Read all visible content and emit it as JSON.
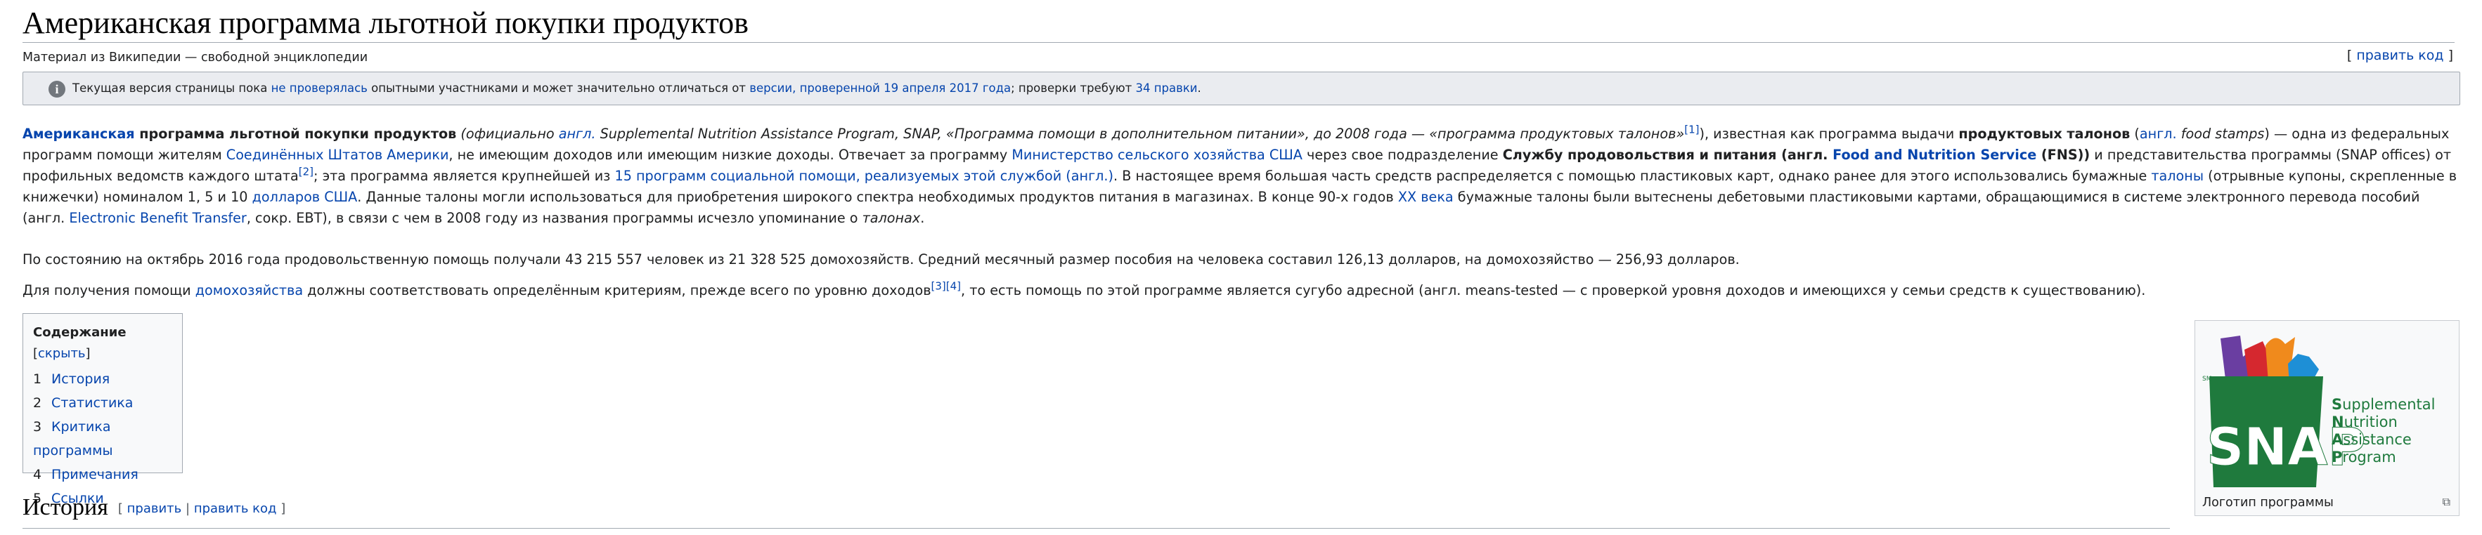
{
  "page": {
    "title": "Американская программа льготной покупки продуктов",
    "tagline": "Материал из Википедии — свободной энциклопедии",
    "edit_code_label": "править код"
  },
  "notice": {
    "icon": "info-icon",
    "prefix": "Текущая версия страницы пока ",
    "link_unchecked": "не проверялась",
    "middle": " опытными участниками и может значительно отличаться от ",
    "link_version": "версии, проверенной 19 апреля 2017 года",
    "after": "; проверки требуют ",
    "link_edits": "34 правки",
    "end": "."
  },
  "paragraph1": {
    "t1": "Американская",
    "t2": " программа льготной покупки продуктов",
    "t3": " (официально ",
    "t4": "англ.",
    "t5": " Supplemental Nutrition Assistance Program, SNAP, «Программа помощи в дополнительном питании», до 2008 года — «программа продуктовых талонов»",
    "t6": "[1]",
    "t7": "), известная как программа выдачи ",
    "t8": "продуктовых талонов",
    "t9": " (",
    "t10": "англ.",
    "t11": " food stamps",
    "t12": ") — одна из федеральных программ помощи жителям ",
    "t13": "Соединённых Штатов Америки",
    "t14": ", не имеющим доходов или имеющим низкие доходы. Отвечает за программу ",
    "t15": "Министерство сельского хозяйства США",
    "t16": " через свое подразделение ",
    "t17": "Службу продовольствия и питания (англ. ",
    "t18": "Food and Nutrition Service",
    "t19": " (FNS))",
    "t20": " и представительства программы (SNAP offices) от профильных ведомств каждого штата",
    "t21": "[2]",
    "t22": "; эта программа является крупнейшей из ",
    "t23": "15 программ социальной помощи, реализуемых этой службой (англ.)",
    "t24": ". В настоящее время большая часть средств распределяется с помощью пластиковых карт, однако ранее для этого использовались бумажные ",
    "t25": "талоны",
    "t26": " (отрывные купоны, скрепленные в книжечки) номиналом 1, 5 и 10 ",
    "t27": "долларов США",
    "t28": ". Данные талоны могли использоваться для приобретения широкого спектра необходимых продуктов питания в магазинах. В конце 90-х годов ",
    "t29": "XX века",
    "t30": " бумажные талоны были вытеснены дебетовыми пластиковыми картами, обращающимися в системе электронного перевода пособий (англ. ",
    "t31": "Electronic Benefit Transfer",
    "t32": ", сокр. EBT), в связи с чем в 2008 году из названия программы исчезло упоминание о ",
    "t33": "талонах",
    "t34": "."
  },
  "paragraph2": {
    "text": "По состоянию на октябрь 2016 года продовольственную помощь получали 43 215 557 человек из 21 328 525 домохозяйств. Средний месячный размер пособия на человека составил 126,13 долларов, на домохозяйство — 256,93 долларов."
  },
  "paragraph3": {
    "t1": "Для получения помощи ",
    "t2": "домохозяйства",
    "t3": " должны соответствовать определённым критериям, прежде всего по уровню доходов",
    "t4": "[3]",
    "t5": "[4]",
    "t6": ", то есть помощь по этой программе является сугубо адресной (англ. means-tested — с проверкой уровня доходов и имеющихся у семьи средств к существованию)."
  },
  "toc": {
    "title": "Содержание",
    "toggle": "скрыть",
    "items": [
      {
        "num": "1",
        "label": "История"
      },
      {
        "num": "2",
        "label": "Статистика"
      },
      {
        "num": "3",
        "label": "Критика программы"
      },
      {
        "num": "4",
        "label": "Примечания"
      },
      {
        "num": "5",
        "label": "Ссылки"
      }
    ]
  },
  "section": {
    "heading": "История",
    "edit_label": "править",
    "separator": "|",
    "edit_code_label": "править код"
  },
  "infobox": {
    "logo_word": "SNAP",
    "logo_sm": "SM",
    "logo_lines": [
      {
        "first": "S",
        "rest": "upplemental"
      },
      {
        "first": "N",
        "rest": "utrition"
      },
      {
        "first": "A",
        "rest": "ssistance"
      },
      {
        "first": "P",
        "rest": "rogram"
      }
    ],
    "caption": "Логотип программы",
    "icon": "enlarge-icon",
    "colors": {
      "green": "#1f7a3d",
      "purple": "#6a3ea1",
      "red": "#d5282f",
      "orange": "#f08a1c",
      "blue": "#1e8fd6"
    }
  }
}
